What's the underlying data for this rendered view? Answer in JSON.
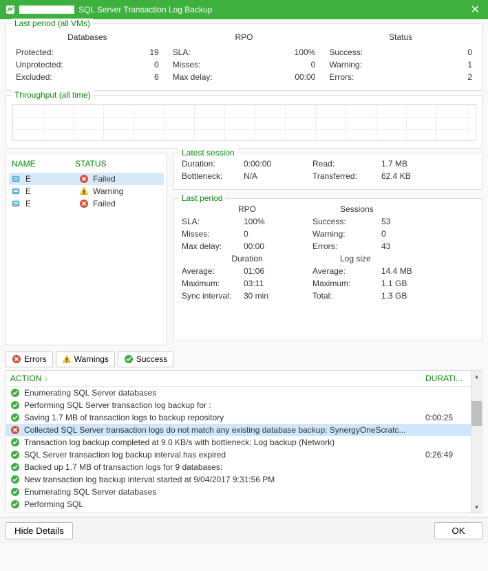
{
  "title": "SQL Server Transaction Log Backup",
  "last_period": {
    "title": "Last period (all VMs)",
    "headers": {
      "db": "Databases",
      "rpo": "RPO",
      "status": "Status"
    },
    "db": {
      "protected_label": "Protected:",
      "protected": "19",
      "unprotected_label": "Unprotected:",
      "unprotected": "0",
      "excluded_label": "Excluded:",
      "excluded": "6"
    },
    "rpo": {
      "sla_label": "SLA:",
      "sla": "100%",
      "misses_label": "Misses:",
      "misses": "0",
      "maxdelay_label": "Max delay:",
      "maxdelay": "00:00"
    },
    "status": {
      "success_label": "Success:",
      "success": "0",
      "warning_label": "Warning:",
      "warning": "1",
      "errors_label": "Errors:",
      "errors": "2"
    }
  },
  "throughput": {
    "title": "Throughput (all time)"
  },
  "vmlist": {
    "headers": {
      "name": "NAME",
      "status": "STATUS"
    },
    "rows": [
      {
        "name": "E",
        "status": "Failed",
        "icon": "error"
      },
      {
        "name": "E",
        "status": "Warning",
        "icon": "warning"
      },
      {
        "name": "E",
        "status": "Failed",
        "icon": "error"
      }
    ]
  },
  "latest_session": {
    "title": "Latest session",
    "duration_label": "Duration:",
    "duration": "0:00:00",
    "read_label": "Read:",
    "read": "1.7 MB",
    "bottleneck_label": "Bottleneck:",
    "bottleneck": "N/A",
    "transferred_label": "Transferred:",
    "transferred": "62.4 KB"
  },
  "last_period_detail": {
    "title": "Last period",
    "headers": {
      "rpo": "RPO",
      "sessions": "Sessions",
      "duration": "Duration",
      "logsize": "Log size"
    },
    "rpo": {
      "sla_label": "SLA:",
      "sla": "100%",
      "misses_label": "Misses:",
      "misses": "0",
      "maxdelay_label": "Max delay:",
      "maxdelay": "00:00"
    },
    "sessions": {
      "success_label": "Success:",
      "success": "53",
      "warning_label": "Warning:",
      "warning": "0",
      "errors_label": "Errors:",
      "errors": "43"
    },
    "duration": {
      "avg_label": "Average:",
      "avg": "01:06",
      "max_label": "Maximum:",
      "max": "03:11",
      "sync_label": "Sync interval:",
      "sync": "30 min"
    },
    "logsize": {
      "avg_label": "Average:",
      "avg": "14.4 MB",
      "max_label": "Maximum:",
      "max": "1.1 GB",
      "total_label": "Total:",
      "total": "1.3 GB"
    }
  },
  "filters": {
    "errors": "Errors",
    "warnings": "Warnings",
    "success": "Success"
  },
  "log": {
    "headers": {
      "action": "ACTION",
      "duration": "DURATI..."
    },
    "rows": [
      {
        "icon": "success",
        "text": "Enumerating SQL Server databases",
        "dur": ""
      },
      {
        "icon": "success",
        "text": "Performing SQL Server transaction log backup for :",
        "dur": ""
      },
      {
        "icon": "success",
        "text": "Saving 1.7 MB of transaction logs to backup repository",
        "dur": "0:00:25"
      },
      {
        "icon": "error",
        "text": "Collected SQL Server transaction logs do not match any existing database backup: SynergyOneScratc...",
        "dur": "",
        "selected": true
      },
      {
        "icon": "success",
        "text": "Transaction log backup completed at 9.0 KB/s with bottleneck: Log backup (Network)",
        "dur": ""
      },
      {
        "icon": "success",
        "text": "SQL Server transaction log backup interval has expired",
        "dur": "0:26:49"
      },
      {
        "icon": "success",
        "text": "Backed up 1.7 MB of transaction logs for 9 databases:",
        "dur": ""
      },
      {
        "icon": "success",
        "text": "New transaction log backup interval started at 9/04/2017 9:31:56 PM",
        "dur": ""
      },
      {
        "icon": "success",
        "text": "Enumerating SQL Server databases",
        "dur": ""
      },
      {
        "icon": "success",
        "text": "Performing SQL",
        "dur": ""
      }
    ]
  },
  "footer": {
    "hide": "Hide Details",
    "ok": "OK"
  },
  "colors": {
    "green": "#3db03d",
    "link": "#0a8a0a"
  }
}
